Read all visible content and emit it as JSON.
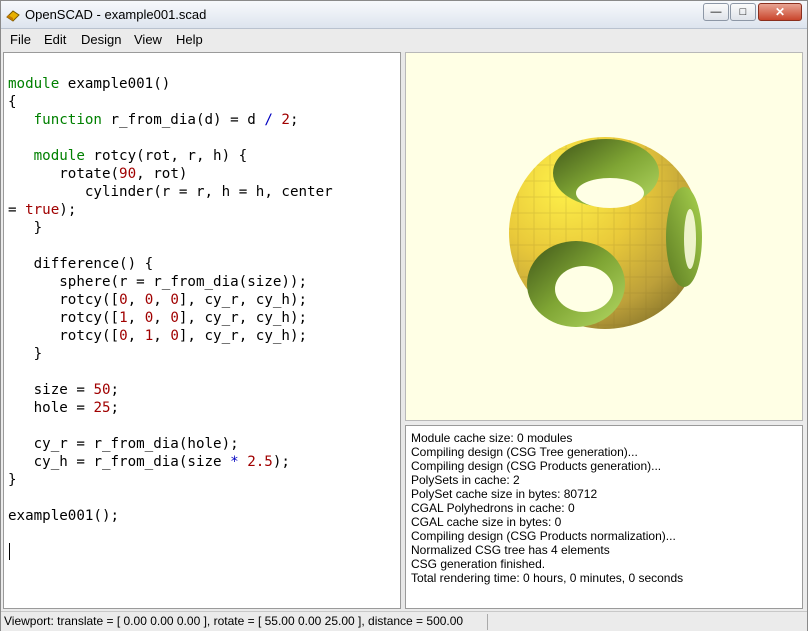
{
  "window": {
    "title": "OpenSCAD - example001.scad",
    "minimize_glyph": "—",
    "maximize_glyph": "□",
    "close_glyph": "✕"
  },
  "menu": [
    "File",
    "Edit",
    "Design",
    "View",
    "Help"
  ],
  "editor": {
    "lines": [
      "module example001()",
      "{",
      "   function r_from_dia(d) = d / 2;",
      "",
      "   module rotcy(rot, r, h) {",
      "      rotate(90, rot)",
      "         cylinder(r = r, h = h, center",
      "= true);",
      "   }",
      "",
      "   difference() {",
      "      sphere(r = r_from_dia(size));",
      "      rotcy([0, 0, 0], cy_r, cy_h);",
      "      rotcy([1, 0, 0], cy_r, cy_h);",
      "      rotcy([0, 1, 0], cy_r, cy_h);",
      "   }",
      "",
      "   size = 50;",
      "   hole = 25;",
      "",
      "   cy_r = r_from_dia(hole);",
      "   cy_h = r_from_dia(size * 2.5);",
      "}",
      "",
      "example001();",
      ""
    ]
  },
  "console": {
    "lines": [
      "Module cache size: 0 modules",
      "Compiling design (CSG Tree generation)...",
      "Compiling design (CSG Products generation)...",
      "PolySets in cache: 2",
      "PolySet cache size in bytes: 80712",
      "CGAL Polyhedrons in cache: 0",
      "CGAL cache size in bytes: 0",
      "Compiling design (CSG Products normalization)...",
      "Normalized CSG tree has 4 elements",
      "CSG generation finished.",
      "Total rendering time: 0 hours, 0 minutes, 0 seconds"
    ]
  },
  "status": {
    "viewport": "Viewport: translate = [ 0.00 0.00 0.00 ], rotate = [ 55.00 0.00 25.00 ], distance = 500.00"
  },
  "colors": {
    "viewer_bg": "#ffffe5",
    "sphere_yellow": "#f2d23a",
    "sphere_olive": "#b9a63a",
    "hole_green": "#8fbf3a",
    "hole_dark": "#4f6a1d"
  }
}
